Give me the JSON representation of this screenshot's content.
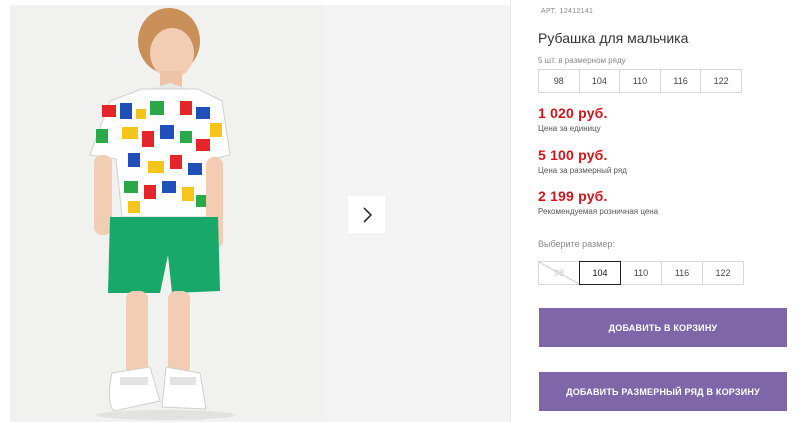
{
  "product": {
    "sku_label": "АРТ.",
    "sku_value": "12412141",
    "title": "Рубашка для мальчика"
  },
  "pack": {
    "hint": "5 шт. в размерном ряду",
    "sizes": [
      "98",
      "104",
      "110",
      "116",
      "122"
    ]
  },
  "prices": [
    {
      "value": "1 020 руб.",
      "label": "Цена за единицу"
    },
    {
      "value": "5 100 руб.",
      "label": "Цена за размерный ряд"
    },
    {
      "value": "2 199 руб.",
      "label": "Рекомендуемая розничная цена"
    }
  ],
  "size_select": {
    "label": "Выберите размер:",
    "sizes": [
      "98",
      "104",
      "110",
      "116",
      "122"
    ],
    "selected": "104",
    "unavailable": [
      "98"
    ]
  },
  "buttons": {
    "add_to_cart": "ДОБАВИТЬ В КОРЗИНУ",
    "add_pack_to_cart": "ДОБАВИТЬ РАЗМЕРНЫЙ РЯД В КОРЗИНУ"
  },
  "colors": {
    "price_red": "#d0151c",
    "button_purple": "#7f66a8",
    "shorts_green": "#17a86a"
  },
  "icons": {
    "next": "chevron-right-icon"
  }
}
